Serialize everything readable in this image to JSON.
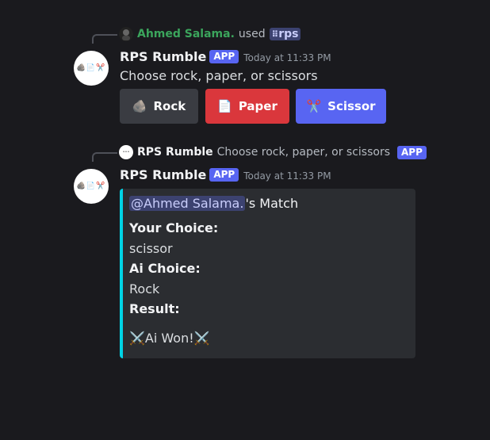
{
  "message1": {
    "reply_user": "Ahmed Salama.",
    "reply_user_color": "#3ba55c",
    "reply_used": "used",
    "reply_command": "rps",
    "author": "RPS Rumble",
    "app_badge": "APP",
    "timestamp": "Today at 11:33 PM",
    "text": "Choose rock, paper, or scissors",
    "buttons": [
      {
        "label": "Rock",
        "emoji": "🪨",
        "color": "#3a3c42"
      },
      {
        "label": "Paper",
        "emoji": "📄",
        "color": "#da373c"
      },
      {
        "label": "Scissor",
        "emoji": "✂️",
        "color": "#5865f2"
      }
    ]
  },
  "message2": {
    "reply_author": "RPS Rumble",
    "reply_text": "Choose rock, paper, or scissors",
    "reply_badge": "APP",
    "author": "RPS Rumble",
    "app_badge": "APP",
    "timestamp": "Today at 11:33 PM",
    "embed": {
      "accent": "#00d4e6",
      "mention": "@Ahmed Salama.",
      "title_suffix": "'s Match",
      "your_choice_label": "Your Choice:",
      "your_choice_value": "scissor",
      "ai_choice_label": "Ai Choice:",
      "ai_choice_value": "Rock",
      "result_label": "Result:",
      "result_icon": "⚔️",
      "result_value": "Ai Won!"
    }
  },
  "avatar_emojis": "🪨📄✂️"
}
